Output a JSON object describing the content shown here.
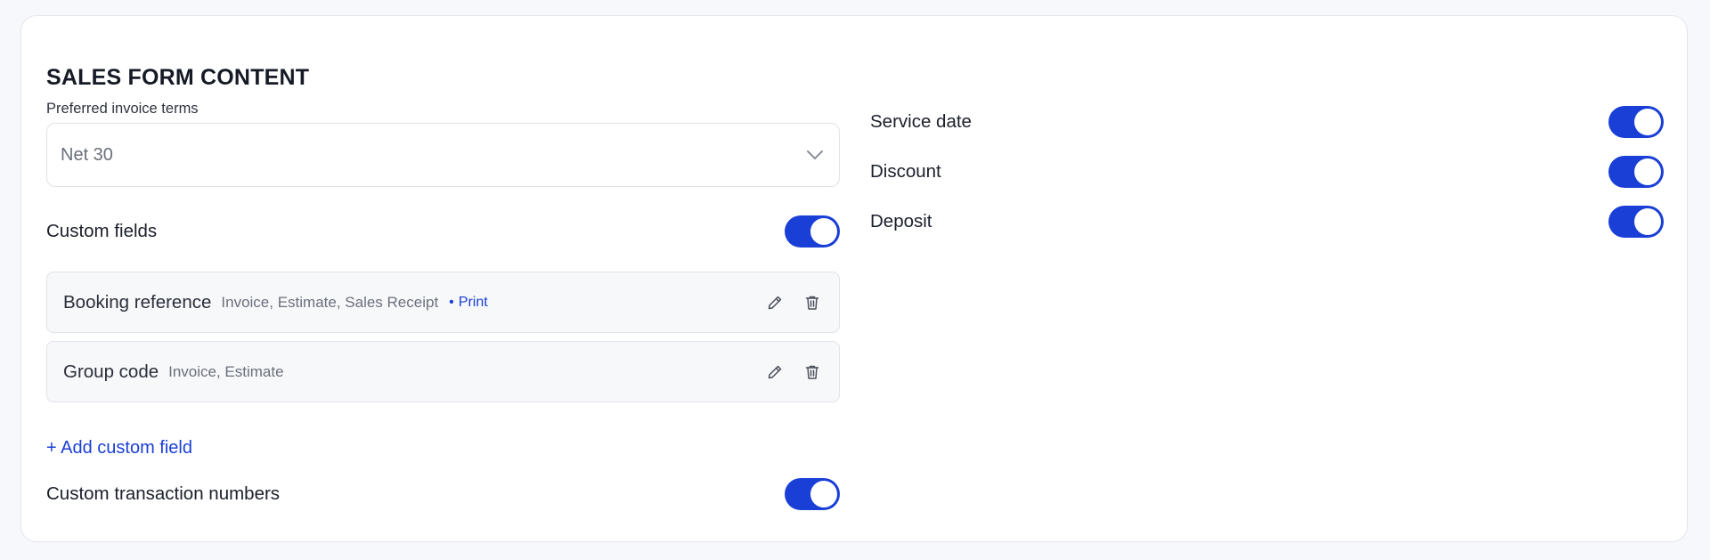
{
  "section": {
    "title": "SALES FORM CONTENT"
  },
  "invoice_terms": {
    "label": "Preferred invoice terms",
    "value": "Net 30"
  },
  "custom_fields": {
    "label": "Custom fields",
    "enabled": true,
    "items": [
      {
        "name": "Booking reference",
        "forms": "Invoice, Estimate, Sales Receipt",
        "print_label": "Print"
      },
      {
        "name": "Group code",
        "forms": "Invoice, Estimate"
      }
    ],
    "add_label": "+ Add custom field"
  },
  "custom_transaction_numbers": {
    "label": "Custom transaction numbers",
    "enabled": true
  },
  "right_options": [
    {
      "label": "Service date",
      "enabled": true
    },
    {
      "label": "Discount",
      "enabled": true
    },
    {
      "label": "Deposit",
      "enabled": true
    }
  ],
  "colors": {
    "accent": "#1a3fd6",
    "card_bg": "#ffffff",
    "page_bg": "#f7f8fb",
    "item_bg": "#f7f8fa"
  },
  "icons": {
    "select": "chevron-down-icon",
    "edit": "pencil-icon",
    "delete": "trash-icon"
  }
}
